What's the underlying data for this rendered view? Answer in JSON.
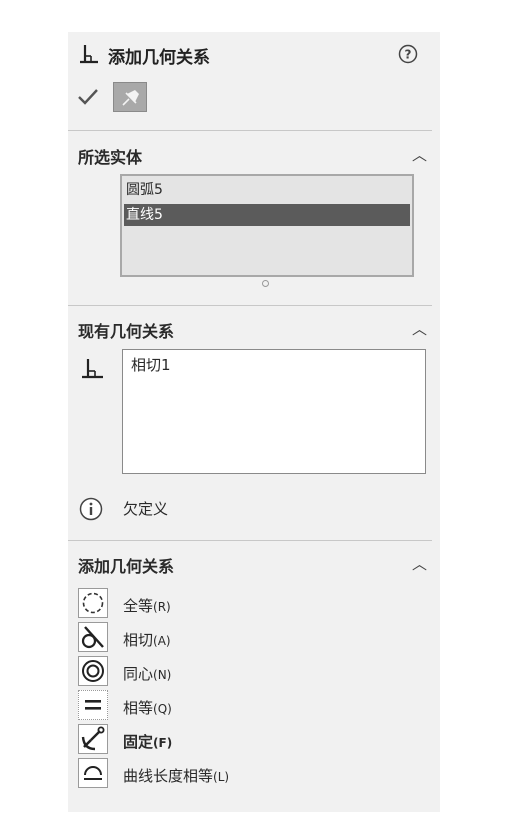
{
  "header": {
    "title": "添加几何关系",
    "title_icon": "perpendicular-constraint-icon",
    "help_icon": "question-circle-icon",
    "ok_icon": "checkmark-icon",
    "pin_icon": "pushpin-icon"
  },
  "selected_entities": {
    "heading": "所选实体",
    "items": [
      {
        "label": "圆弧5",
        "selected": false
      },
      {
        "label": "直线5",
        "selected": true
      }
    ]
  },
  "existing_relations": {
    "heading": "现有几何关系",
    "items": [
      "相切1"
    ],
    "status": "欠定义",
    "status_icon": "info-circle-icon"
  },
  "add_relations": {
    "heading": "添加几何关系",
    "items": [
      {
        "name": "coradial",
        "label": "全等",
        "shortcut": "(R)",
        "icon": "dashed-circle-icon",
        "bold": false
      },
      {
        "name": "tangent",
        "label": "相切",
        "shortcut": "(A)",
        "icon": "tangent-icon",
        "bold": false
      },
      {
        "name": "concentric",
        "label": "同心",
        "shortcut": "(N)",
        "icon": "concentric-circles-icon",
        "bold": false
      },
      {
        "name": "equal",
        "label": "相等",
        "shortcut": "(Q)",
        "icon": "equal-sign-icon",
        "bold": false
      },
      {
        "name": "fix",
        "label": "固定",
        "shortcut": "(F)",
        "icon": "anchor-fix-icon",
        "bold": true
      },
      {
        "name": "equal-curve-length",
        "label": "曲线长度相等",
        "shortcut": "(L)",
        "icon": "arc-length-icon",
        "bold": false
      }
    ]
  },
  "colors": {
    "panel_bg": "#f1f1f1",
    "selected_row_bg": "#5b5b5b",
    "listbox_bg": "#e4e4e4"
  }
}
